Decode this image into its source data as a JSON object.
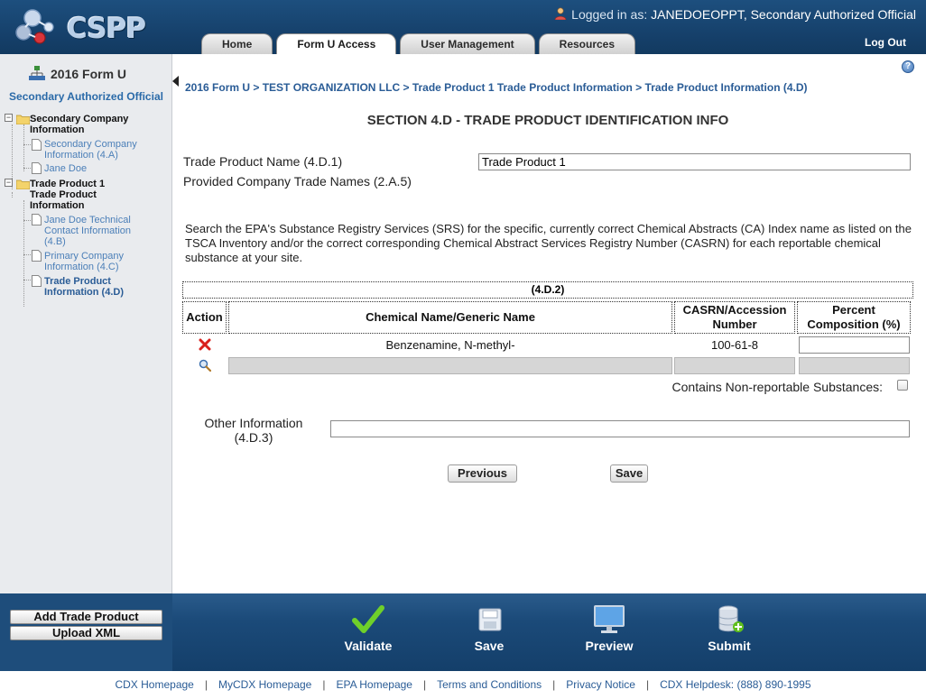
{
  "header": {
    "logo_text": "CSPP",
    "logged_in_prefix": "Logged in as:",
    "logged_in_user": "JANEDOEOPPT, Secondary Authorized Official",
    "tabs": [
      {
        "label": "Home"
      },
      {
        "label": "Form U Access"
      },
      {
        "label": "User Management"
      },
      {
        "label": "Resources"
      }
    ],
    "active_tab": "Form U Access",
    "logout": "Log Out"
  },
  "sidebar": {
    "title": "2016 Form U",
    "role": "Secondary Authorized Official",
    "tree": [
      {
        "label": "Secondary Company Information",
        "type": "folder"
      },
      {
        "label": "Secondary Company Information (4.A)",
        "type": "leaf"
      },
      {
        "label": "Jane Doe",
        "type": "leaf"
      },
      {
        "label": "Trade Product 1 Trade Product Information",
        "type": "folder"
      },
      {
        "label": "Jane Doe Technical Contact Information (4.B)",
        "type": "leaf"
      },
      {
        "label": "Primary Company Information (4.C)",
        "type": "leaf"
      },
      {
        "label": "Trade Product Information (4.D)",
        "type": "leaf",
        "current": true
      }
    ],
    "buttons": {
      "add_trade_product": "Add Trade Product",
      "upload_xml": "Upload XML"
    }
  },
  "breadcrumb": "2016 Form U > TEST ORGANIZATION LLC > Trade Product 1 Trade Product Information > Trade Product Information (4.D)",
  "section_title": "SECTION 4.D - TRADE PRODUCT IDENTIFICATION INFO",
  "form": {
    "trade_product_name_label": "Trade Product Name (4.D.1)",
    "trade_product_name_value": "Trade Product 1",
    "provided_trade_names_label": "Provided Company Trade Names (2.A.5)",
    "instructions": "Search the EPA's Substance Registry Services (SRS) for the specific, currently correct Chemical Abstracts (CA) Index name as listed on the TSCA Inventory and/or the correct corresponding Chemical Abstract Services Registry Number (CASRN) for each reportable chemical substance at your site.",
    "other_info_label_line1": "Other Information",
    "other_info_label_line2": "(4.D.3)",
    "other_info_value": ""
  },
  "table": {
    "caption": "(4.D.2)",
    "headers": {
      "action": "Action",
      "chemical_name": "Chemical Name/Generic Name",
      "casrn": "CASRN/Accession Number",
      "percent": "Percent Composition (%)"
    },
    "rows": [
      {
        "chemical_name": "Benzenamine, N-methyl-",
        "casrn": "100-61-8",
        "percent": ""
      }
    ],
    "non_reportable_label": "Contains Non-reportable Substances:",
    "non_reportable_checked": false
  },
  "buttons": {
    "previous": "Previous",
    "save": "Save"
  },
  "action_bar": [
    {
      "label": "Validate",
      "icon": "checkmark-icon"
    },
    {
      "label": "Save",
      "icon": "floppy-icon"
    },
    {
      "label": "Preview",
      "icon": "monitor-icon"
    },
    {
      "label": "Submit",
      "icon": "database-icon"
    }
  ],
  "footer": [
    "CDX Homepage",
    "MyCDX Homepage",
    "EPA Homepage",
    "Terms and Conditions",
    "Privacy Notice",
    "CDX Helpdesk: (888) 890-1995"
  ],
  "colors": {
    "header_blue": "#1d4f7e",
    "link_blue": "#2a5c96",
    "sidebar_bg": "#e9ebee",
    "validate_green": "#5fbf1d",
    "delete_red": "#d9201c"
  }
}
